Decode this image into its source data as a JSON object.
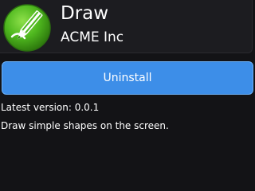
{
  "app": {
    "icon": "pencil-icon",
    "title": "Draw",
    "developer": "ACME Inc"
  },
  "actions": {
    "uninstall_label": "Uninstall"
  },
  "details": {
    "version": "Latest version: 0.0.1",
    "description": "Draw simple shapes on the screen."
  },
  "colors": {
    "background": "#131316",
    "header_bg": "#1c1c20",
    "button": "#3d8ee8",
    "button_border": "#6bb0f7",
    "icon_green": "#4fb81f"
  }
}
